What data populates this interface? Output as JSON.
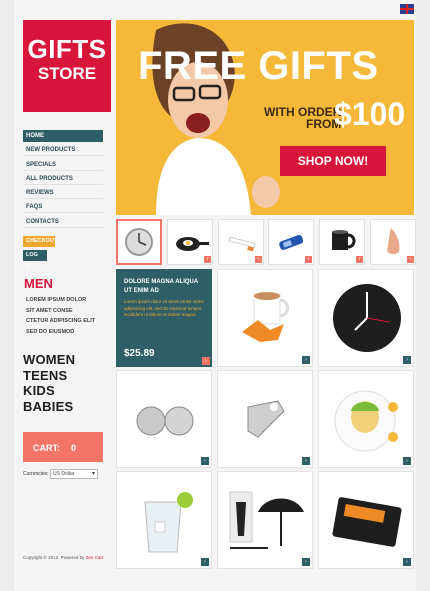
{
  "logo": {
    "line1": "GIFTS",
    "line2": "STORE"
  },
  "menu": [
    {
      "label": "HOME",
      "active": true
    },
    {
      "label": "NEW PRODUCTS"
    },
    {
      "label": "SPECIALS"
    },
    {
      "label": "ALL PRODUCTS"
    },
    {
      "label": "REVIEWS"
    },
    {
      "label": "FAQS"
    },
    {
      "label": "CONTACTS"
    }
  ],
  "account": {
    "checkout": "CHECKOUT",
    "login": "LOG IN"
  },
  "men": {
    "title": "MEN",
    "items": [
      "LOREM IPSUM DOLOR",
      "SIT AMET CONSE",
      "CTETUR ADIPISCING ELIT",
      "SED DO EIUSMOD"
    ]
  },
  "categories": [
    "WOMEN",
    "TEENS",
    "KIDS",
    "BABIES"
  ],
  "cart": {
    "label": "CART:",
    "count": "0"
  },
  "currency": {
    "label": "Currencies:",
    "selected": "US Dollar"
  },
  "footer": {
    "copyright": "Copyright © 2012.",
    "powered_prefix": " Powered by ",
    "powered_by": "Zen Cart"
  },
  "banner": {
    "title": "FREE GIFTS",
    "sub1": "WITH ORDER",
    "sub2": "FROM",
    "amount": "$100",
    "button": "SHOP NOW!"
  },
  "thumbnails": [
    "clock-icon",
    "pan-icon",
    "cigarette-icon",
    "lighter-icon",
    "mug-icon",
    "nose-icon"
  ],
  "featured": {
    "title": "DOLORE MAGNA ALIQUA UT ENIM AD",
    "desc": "Lorem ipsum dolor sit amet conse ctetur adipisicing elit, sed do eiusmod tempor incididunt ut labore et dolore magna",
    "price": "$25.89"
  },
  "colors": {
    "accent": "#d8153b",
    "teal": "#2f5f66",
    "coral": "#f27466",
    "banner": "#f5b839"
  }
}
